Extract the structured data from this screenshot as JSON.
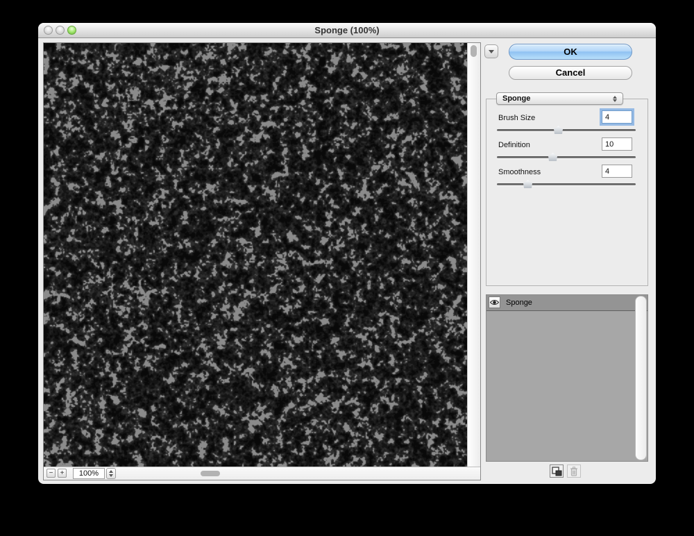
{
  "window": {
    "title": "Sponge (100%)"
  },
  "actions": {
    "ok_label": "OK",
    "cancel_label": "Cancel"
  },
  "filter_menu": {
    "selected": "Sponge"
  },
  "parameters": [
    {
      "label": "Brush Size",
      "value": "4",
      "slider_percent": 44,
      "focused": true
    },
    {
      "label": "Definition",
      "value": "10",
      "slider_percent": 40,
      "focused": false
    },
    {
      "label": "Smoothness",
      "value": "4",
      "slider_percent": 22,
      "focused": false
    }
  ],
  "preview": {
    "zoom_level": "100%",
    "zoom_out_label": "−",
    "zoom_in_label": "+"
  },
  "effect_layers": {
    "selected_index": 0,
    "items": [
      {
        "name": "Sponge",
        "visible": true
      }
    ]
  },
  "colors": {
    "ok_button_blue": "#9cc8f4",
    "focus_ring": "#78aae1",
    "selected_row_gray": "#949494",
    "layer_panel_gray": "#a7a7a7",
    "texture_light_gray": "#8b8b8b",
    "texture_dark": "#0a0a0a",
    "window_gray": "#ececec"
  }
}
